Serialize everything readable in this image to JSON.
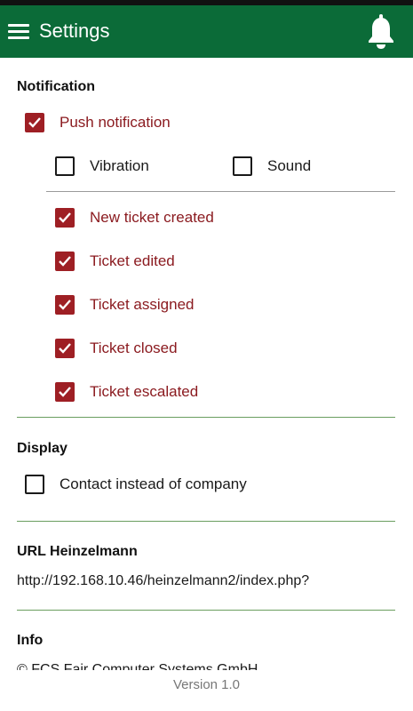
{
  "appbar": {
    "title": "Settings"
  },
  "notification": {
    "title": "Notification",
    "push": {
      "label": "Push notification",
      "checked": true
    },
    "vibration": {
      "label": "Vibration",
      "checked": false
    },
    "sound": {
      "label": "Sound",
      "checked": false
    },
    "events": [
      {
        "label": "New ticket created",
        "checked": true
      },
      {
        "label": "Ticket edited",
        "checked": true
      },
      {
        "label": "Ticket assigned",
        "checked": true
      },
      {
        "label": "Ticket closed",
        "checked": true
      },
      {
        "label": "Ticket escalated",
        "checked": true
      }
    ]
  },
  "display": {
    "title": "Display",
    "contact_instead": {
      "label": "Contact instead of company",
      "checked": false
    }
  },
  "url": {
    "title": "URL Heinzelmann",
    "value": "http://192.168.10.46/heinzelmann2/index.php?"
  },
  "info": {
    "title": "Info",
    "text": "© FCS Fair Computer Systems GmbH"
  },
  "footer": {
    "version": "Version 1.0"
  },
  "colors": {
    "appbar": "#0b6b38",
    "accent": "#9e1f24",
    "divider": "#6a9e5f"
  }
}
